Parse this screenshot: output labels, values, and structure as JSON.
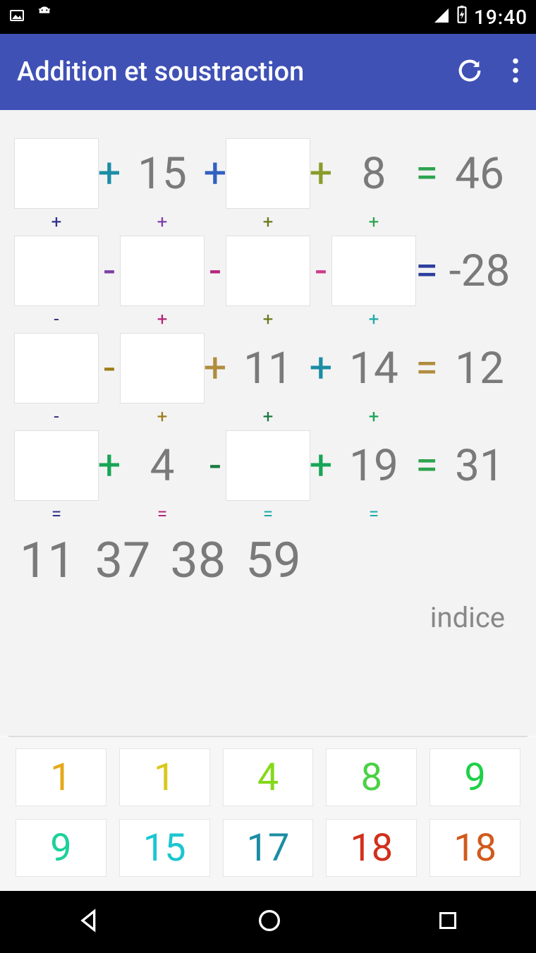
{
  "status": {
    "time": "19:40"
  },
  "header": {
    "title": "Addition et soustraction"
  },
  "puzzle": {
    "rows": [
      {
        "cells": [
          {
            "t": "box"
          },
          {
            "t": "op",
            "v": "+",
            "c": "c-teal"
          },
          {
            "t": "num",
            "v": "15"
          },
          {
            "t": "op",
            "v": "+",
            "c": "c-blue2"
          },
          {
            "t": "box"
          },
          {
            "t": "op",
            "v": "+",
            "c": "c-olive"
          },
          {
            "t": "num",
            "v": "8"
          },
          {
            "t": "op",
            "v": "=",
            "c": "c-green"
          },
          {
            "t": "num",
            "v": "46"
          }
        ]
      },
      {
        "vops": [
          {
            "v": "+",
            "c": "c-indigo"
          },
          {
            "v": "+",
            "c": "c-purple"
          },
          {
            "v": "+",
            "c": "c-olive2"
          },
          {
            "v": "+",
            "c": "c-green"
          }
        ]
      },
      {
        "cells": [
          {
            "t": "box"
          },
          {
            "t": "op",
            "v": "-",
            "c": "c-purple"
          },
          {
            "t": "box"
          },
          {
            "t": "op",
            "v": "-",
            "c": "c-mag"
          },
          {
            "t": "box"
          },
          {
            "t": "op",
            "v": "-",
            "c": "c-pink"
          },
          {
            "t": "box"
          },
          {
            "t": "op",
            "v": "=",
            "c": "c-dblue"
          },
          {
            "t": "num",
            "v": "-28"
          }
        ]
      },
      {
        "vops": [
          {
            "v": "-",
            "c": "c-navy"
          },
          {
            "v": "+",
            "c": "c-mag"
          },
          {
            "v": "+",
            "c": "c-olive2"
          },
          {
            "v": "+",
            "c": "c-cyan"
          }
        ]
      },
      {
        "cells": [
          {
            "t": "box"
          },
          {
            "t": "op",
            "v": "-",
            "c": "c-brown"
          },
          {
            "t": "box"
          },
          {
            "t": "op",
            "v": "+",
            "c": "c-tan"
          },
          {
            "t": "num",
            "v": "11"
          },
          {
            "t": "op",
            "v": "+",
            "c": "c-teal"
          },
          {
            "t": "num",
            "v": "14"
          },
          {
            "t": "op",
            "v": "=",
            "c": "c-tan"
          },
          {
            "t": "num",
            "v": "12"
          }
        ]
      },
      {
        "vops": [
          {
            "v": "-",
            "c": "c-navy"
          },
          {
            "v": "+",
            "c": "c-brown"
          },
          {
            "v": "+",
            "c": "c-dgreen"
          },
          {
            "v": "+",
            "c": "c-green2"
          }
        ]
      },
      {
        "cells": [
          {
            "t": "box"
          },
          {
            "t": "op",
            "v": "+",
            "c": "c-green2"
          },
          {
            "t": "num",
            "v": "4"
          },
          {
            "t": "op",
            "v": "-",
            "c": "c-dgreen"
          },
          {
            "t": "box"
          },
          {
            "t": "op",
            "v": "+",
            "c": "c-green2"
          },
          {
            "t": "num",
            "v": "19"
          },
          {
            "t": "op",
            "v": "=",
            "c": "c-green"
          },
          {
            "t": "num",
            "v": "31"
          }
        ]
      },
      {
        "vops": [
          {
            "v": "=",
            "c": "c-indigo"
          },
          {
            "v": "=",
            "c": "c-mag"
          },
          {
            "v": "=",
            "c": "c-cyan"
          },
          {
            "v": "=",
            "c": "c-cyan"
          }
        ]
      }
    ],
    "col_totals": [
      "11",
      "37",
      "38",
      "59"
    ],
    "hint_label": "indice"
  },
  "tiles": [
    {
      "v": "1",
      "c": "c-orange"
    },
    {
      "v": "1",
      "c": "c-yellow"
    },
    {
      "v": "4",
      "c": "c-lime"
    },
    {
      "v": "8",
      "c": "c-lgreen"
    },
    {
      "v": "9",
      "c": "c-bgreen"
    },
    {
      "v": "9",
      "c": "c-mint"
    },
    {
      "v": "15",
      "c": "c-tcyan"
    },
    {
      "v": "17",
      "c": "c-teal"
    },
    {
      "v": "18",
      "c": "c-red"
    },
    {
      "v": "18",
      "c": "c-dorange"
    }
  ]
}
